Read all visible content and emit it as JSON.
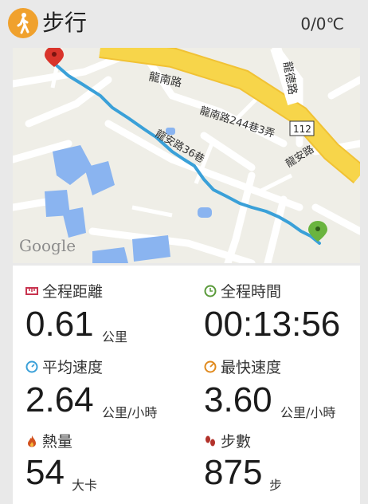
{
  "header": {
    "title": "步行",
    "temperature": "0/0℃"
  },
  "map": {
    "streets": {
      "longnan_road": "龍南路",
      "longde_road": "龍德路",
      "road_112": "112",
      "longnan_lane": "龍南路244巷3弄",
      "longan_lane": "龍安路36巷",
      "longan_road": "龍安路"
    },
    "attribution": "Google"
  },
  "stats": {
    "distance": {
      "label": "全程距離",
      "value": "0.61",
      "unit": "公里"
    },
    "duration": {
      "label": "全程時間",
      "value": "00:13:56"
    },
    "avg_speed": {
      "label": "平均速度",
      "value": "2.64",
      "unit": "公里/小時"
    },
    "max_speed": {
      "label": "最快速度",
      "value": "3.60",
      "unit": "公里/小時"
    },
    "calories": {
      "label": "熱量",
      "value": "54",
      "unit": "大卡"
    },
    "steps": {
      "label": "步數",
      "value": "875",
      "unit": "步"
    }
  },
  "colors": {
    "accent": "#f0a12d",
    "route": "#3aa0d8",
    "major_road": "#f7d54a",
    "water": "#8ab4f0",
    "start_pin": "#d9342b",
    "end_pin": "#6ab43f"
  }
}
